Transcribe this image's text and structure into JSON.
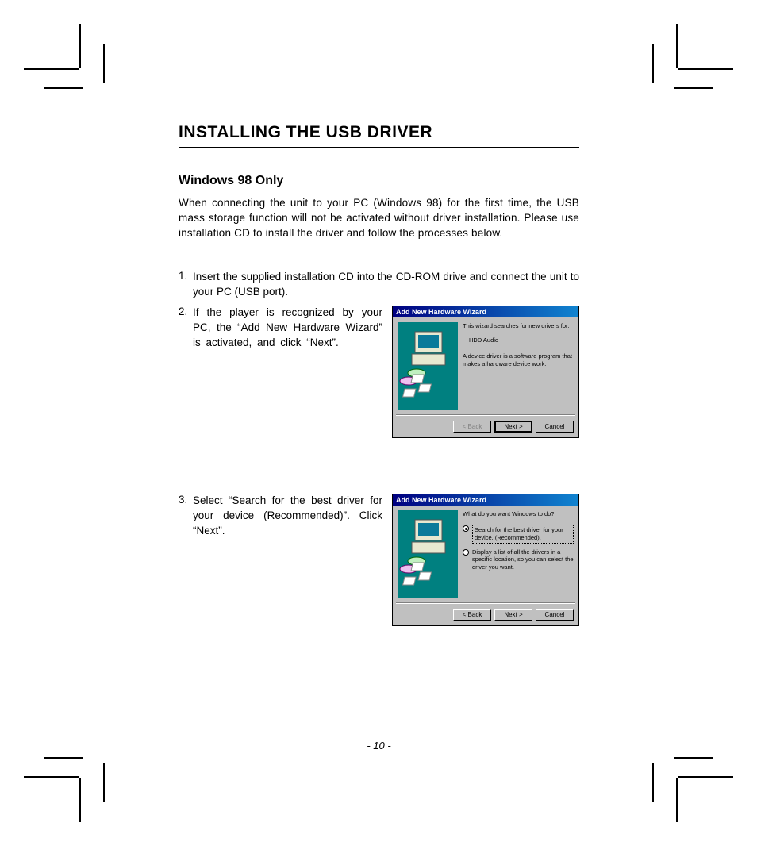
{
  "heading": "INSTALLING THE USB DRIVER",
  "subheading": "Windows 98 Only",
  "intro": "When connecting the unit to your PC (Windows 98) for the first time, the USB mass storage function will not be activated without driver installation. Please use installation CD  to install the driver and follow the processes below.",
  "steps": {
    "s1_num": "1.",
    "s1_text": "Insert the supplied installation CD into the CD-ROM drive and connect the unit to your PC (USB port).",
    "s2_num": "2.",
    "s2_text": "If the player is recognized by your PC, the “Add New Hardware Wizard” is activated, and click “Next”.",
    "s3_num": "3.",
    "s3_text": "Select “Search for the best driver for your device (Recommended)”. Click “Next”."
  },
  "wizard1": {
    "title": "Add New Hardware Wizard",
    "line1": "This wizard searches for new drivers for:",
    "device": "HDD Audio",
    "line2": "A device driver is a software program that makes a hardware device work.",
    "back": "< Back",
    "next": "Next >",
    "cancel": "Cancel"
  },
  "wizard2": {
    "title": "Add New Hardware Wizard",
    "prompt": "What do you want Windows to do?",
    "option1": "Search for the best driver for your device. (Recommended).",
    "option2": "Display a list of all the drivers in a specific location, so you can select the driver you want.",
    "back": "< Back",
    "next": "Next >",
    "cancel": "Cancel"
  },
  "page_number": "- 10 -"
}
